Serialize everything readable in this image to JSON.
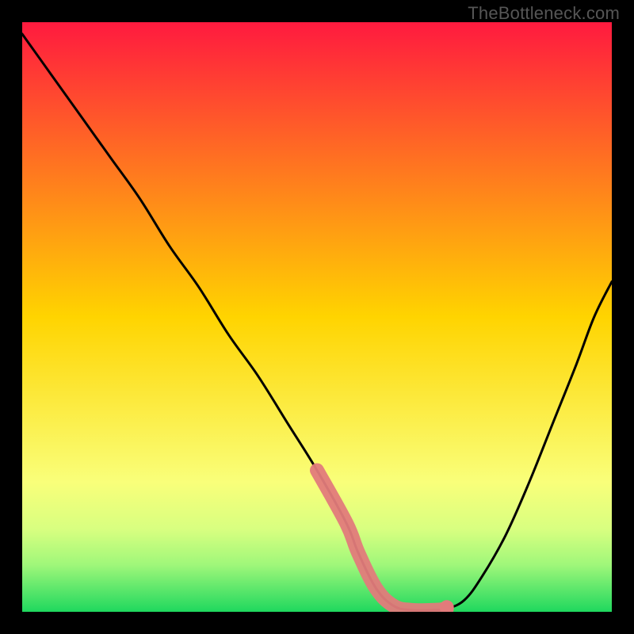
{
  "watermark": "TheBottleneck.com",
  "chart_data": {
    "type": "line",
    "title": "",
    "xlabel": "",
    "ylabel": "",
    "xlim": [
      0,
      100
    ],
    "ylim": [
      0,
      100
    ],
    "grid": false,
    "legend": false,
    "gradient_stops": [
      {
        "offset": 0,
        "color": "#ff1a3f"
      },
      {
        "offset": 50,
        "color": "#ffd400"
      },
      {
        "offset": 78,
        "color": "#f9ff7a"
      },
      {
        "offset": 86,
        "color": "#d8ff80"
      },
      {
        "offset": 92,
        "color": "#a0f77a"
      },
      {
        "offset": 100,
        "color": "#1fd85e"
      }
    ],
    "series": [
      {
        "name": "bottleneck-curve",
        "x": [
          0,
          5,
          10,
          15,
          20,
          25,
          30,
          35,
          40,
          45,
          50,
          55,
          57,
          60,
          63,
          66,
          70,
          72,
          75,
          78,
          82,
          86,
          90,
          94,
          97,
          100
        ],
        "y": [
          98,
          91,
          84,
          77,
          70,
          62,
          55,
          47,
          40,
          32,
          24,
          15,
          10,
          4,
          1,
          0.3,
          0.3,
          0.5,
          2,
          6,
          13,
          22,
          32,
          42,
          50,
          56
        ]
      }
    ],
    "highlight_region": {
      "name": "minimum-band",
      "x_start": 50,
      "x_end": 72,
      "color": "#e27b7b"
    }
  }
}
